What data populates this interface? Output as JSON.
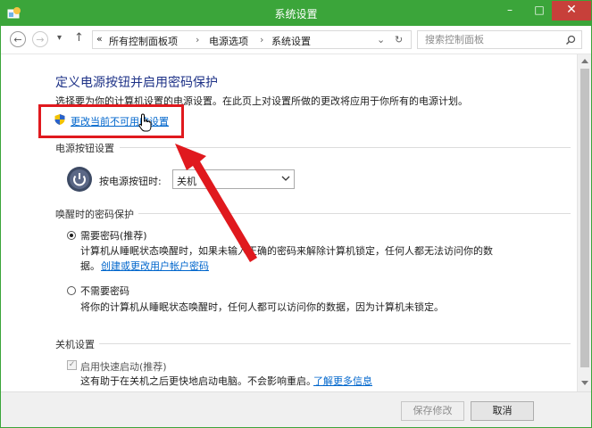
{
  "window": {
    "title": "系统设置",
    "min_glyph": "–",
    "max_glyph": "□",
    "close_glyph": "✕"
  },
  "nav": {
    "back_glyph": "←",
    "forward_glyph": "→",
    "recent_glyph": "▾",
    "up_glyph": "↑",
    "breadcrumb": {
      "prefix": "«",
      "items": [
        "所有控制面板项",
        "电源选项",
        "系统设置"
      ],
      "separator": "›"
    },
    "address_dropdown_glyph": "⌄",
    "refresh_glyph": "↻",
    "search_placeholder": "搜索控制面板"
  },
  "main": {
    "heading": "定义电源按钮并启用密码保护",
    "description": "选择要为你的计算机设置的电源设置。在此页上对设置所做的更改将应用于你所有的电源计划。",
    "change_link": "更改当前不可用的设置",
    "power_section": {
      "title": "电源按钮设置",
      "label": "按电源按钮时:",
      "selected": "关机"
    },
    "password_section": {
      "title": "唤醒时的密码保护",
      "require": {
        "label": "需要密码(推荐)",
        "desc1": "计算机从睡眠状态唤醒时，如果未输入正确的密码来解除计算机锁定，任何人都无法访问你的数",
        "desc2": "据。",
        "link": "创建或更改用户帐户密码",
        "selected": true
      },
      "no_require": {
        "label": "不需要密码",
        "desc": "将你的计算机从睡眠状态唤醒时，任何人都可以访问你的数据，因为计算机未锁定。",
        "selected": false
      }
    },
    "shutdown_section": {
      "title": "关机设置",
      "fast_startup": {
        "label": "启用快速启动(推荐)",
        "desc": "这有助于在关机之后更快地启动电脑。不会影响重启。",
        "link": "了解更多信息",
        "checked": true
      }
    }
  },
  "footer": {
    "save": "保存修改",
    "cancel": "取消"
  },
  "colors": {
    "titlebar": "#3ba53a",
    "close": "#c7403a",
    "heading": "#1e3287",
    "link": "#0066cc",
    "annotation": "#e0191e"
  }
}
